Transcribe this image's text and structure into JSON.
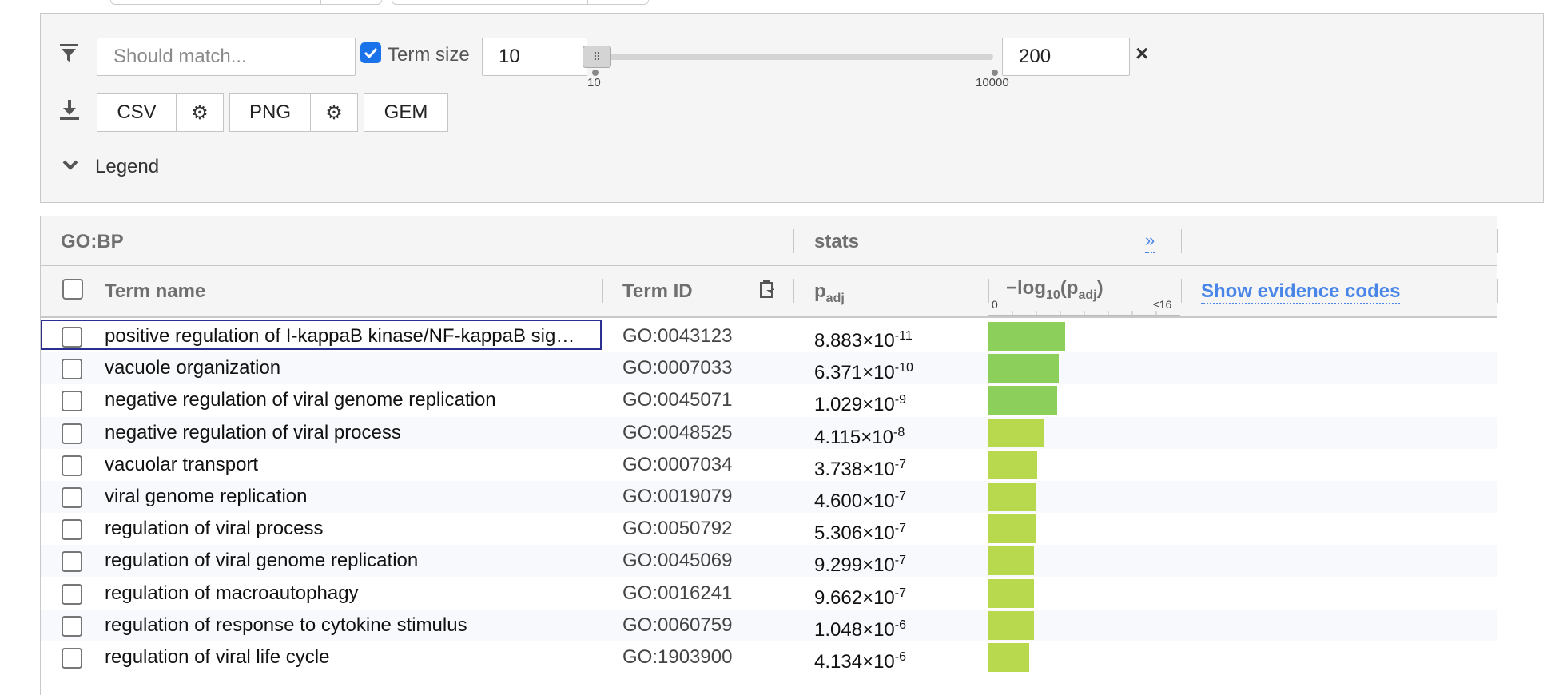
{
  "filter": {
    "placeholder": "Should match...",
    "term_size_label": "Term size",
    "term_size_checked": true,
    "min_value": "10",
    "max_value": "200",
    "slider_min_label": "10",
    "slider_max_label": "10000",
    "clear_symbol": "×"
  },
  "export": {
    "csv_label": "CSV",
    "png_label": "PNG",
    "gem_label": "GEM"
  },
  "legend": {
    "label": "Legend"
  },
  "table": {
    "source": "GO:BP",
    "stats_label": "stats",
    "expand_symbol": "»",
    "columns": {
      "term_name": "Term name",
      "term_id": "Term ID",
      "padj_base": "p",
      "padj_sub": "adj",
      "neglog_prefix": "−log",
      "neglog_base_sub": "10",
      "neglog_open": "(p",
      "neglog_inner_sub": "adj",
      "neglog_close": ")",
      "scale_min": "0",
      "scale_max": "≤16",
      "evidence": "Show evidence codes"
    },
    "bar_color_strong": "#8ccf5a",
    "bar_color_weak": "#b8d94e",
    "rows": [
      {
        "name": "positive regulation of I-kappaB kinase/NF-kappaB signaling",
        "id": "GO:0043123",
        "mant": "8.883",
        "exp": "-11",
        "neglog": 10.05
      },
      {
        "name": "vacuole organization",
        "id": "GO:0007033",
        "mant": "6.371",
        "exp": "-10",
        "neglog": 9.2
      },
      {
        "name": "negative regulation of viral genome replication",
        "id": "GO:0045071",
        "mant": "1.029",
        "exp": "-9",
        "neglog": 8.99
      },
      {
        "name": "negative regulation of viral process",
        "id": "GO:0048525",
        "mant": "4.115",
        "exp": "-8",
        "neglog": 7.39
      },
      {
        "name": "vacuolar transport",
        "id": "GO:0007034",
        "mant": "3.738",
        "exp": "-7",
        "neglog": 6.43
      },
      {
        "name": "viral genome replication",
        "id": "GO:0019079",
        "mant": "4.600",
        "exp": "-7",
        "neglog": 6.34
      },
      {
        "name": "regulation of viral process",
        "id": "GO:0050792",
        "mant": "5.306",
        "exp": "-7",
        "neglog": 6.28
      },
      {
        "name": "regulation of viral genome replication",
        "id": "GO:0045069",
        "mant": "9.299",
        "exp": "-7",
        "neglog": 6.03
      },
      {
        "name": "regulation of macroautophagy",
        "id": "GO:0016241",
        "mant": "9.662",
        "exp": "-7",
        "neglog": 6.01
      },
      {
        "name": "regulation of response to cytokine stimulus",
        "id": "GO:0060759",
        "mant": "1.048",
        "exp": "-6",
        "neglog": 5.98
      },
      {
        "name": "regulation of viral life cycle",
        "id": "GO:1903900",
        "mant": "4.134",
        "exp": "-6",
        "neglog": 5.38
      }
    ]
  }
}
